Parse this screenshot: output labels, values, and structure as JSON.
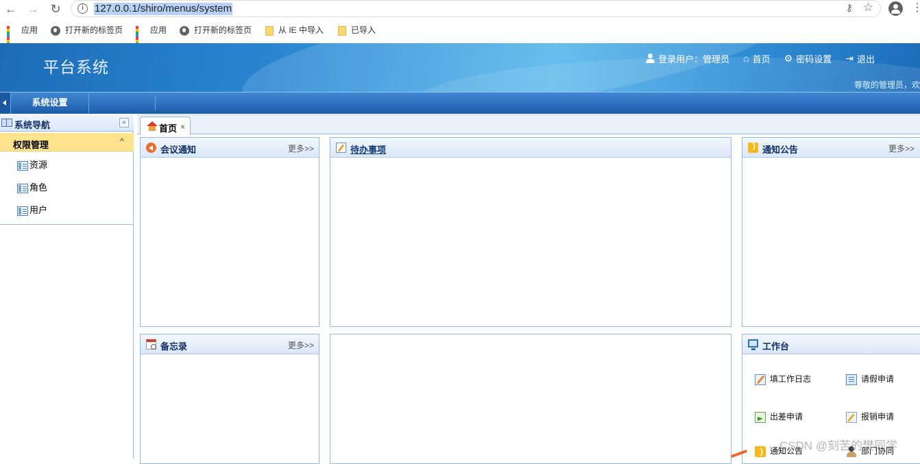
{
  "browser": {
    "back_icon": "arrow-left-icon",
    "forward_icon": "arrow-right-icon",
    "reload_icon": "reload-icon",
    "url": "127.0.0.1/shiro/menus/system",
    "bookmarks": [
      {
        "label": "应用",
        "icon": "apps-grid-icon"
      },
      {
        "label": "打开新的标签页",
        "icon": "globe-icon"
      },
      {
        "label": "应用",
        "icon": "apps-grid-icon"
      },
      {
        "label": "打开新的标签页",
        "icon": "globe-icon"
      },
      {
        "label": "从 IE 中导入",
        "icon": "folder-icon"
      },
      {
        "label": "已导入",
        "icon": "folder-icon"
      }
    ]
  },
  "header": {
    "title": "平台系统",
    "login_user": "登录用户：管理员",
    "home": "首页",
    "password": "密码设置",
    "logout": "退出",
    "welcome": "尊敬的管理员，欢"
  },
  "menubar": {
    "items": [
      "系统设置"
    ]
  },
  "sidebar": {
    "title": "系统导航",
    "collapse_glyph": "«",
    "group": "权限管理",
    "group_caret": "^",
    "items": [
      "资源",
      "角色",
      "用户"
    ]
  },
  "tabs": [
    {
      "label": "首页",
      "close": "×"
    }
  ],
  "panels": {
    "meeting": {
      "title": "会议通知",
      "more": "更多>>"
    },
    "todo": {
      "title": "待办事项"
    },
    "notice": {
      "title": "通知公告",
      "more": "更多>>"
    },
    "memo": {
      "title": "备忘录",
      "more": "更多>>"
    },
    "workbench": {
      "title": "工作台",
      "items": [
        "填工作日志",
        "请假申请",
        "出差申请",
        "报销申请",
        "通知公告",
        "部门协同"
      ]
    }
  },
  "watermark": "CSDN @刻苦的樊同学",
  "colors": {
    "header_blue": "#2a86d2",
    "menu_blue": "#1b5ca8",
    "accordion_yellow": "#ffe48d",
    "panel_border": "#95b8e7"
  }
}
